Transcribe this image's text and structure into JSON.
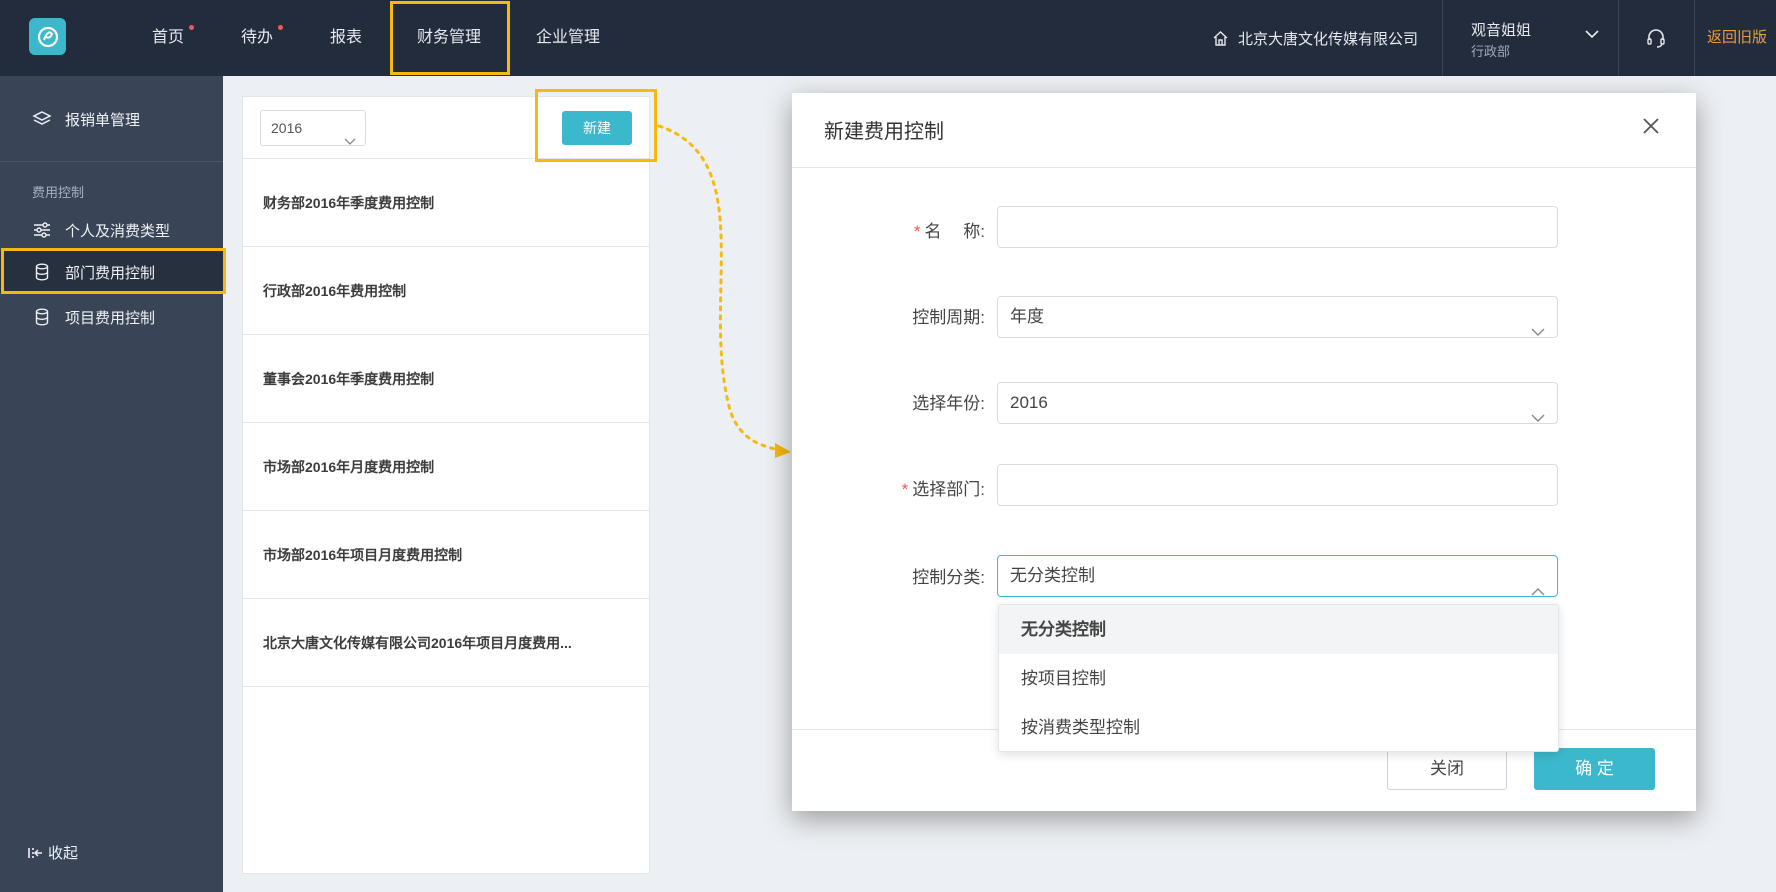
{
  "colors": {
    "topbar": "#232c3d",
    "sidebar": "#3a4457",
    "accent": "#3cb8cc",
    "highlight": "#f6b90d",
    "dot": "#f0595b",
    "old_version": "#ee9b3d"
  },
  "header": {
    "logo_icon": "app-logo-icon",
    "nav": [
      {
        "label": "首页",
        "dot": true
      },
      {
        "label": "待办",
        "dot": true
      },
      {
        "label": "报表",
        "dot": false
      },
      {
        "label": "财务管理",
        "dot": false,
        "active": true
      },
      {
        "label": "企业管理",
        "dot": false
      }
    ],
    "company": "北京大唐文化传媒有限公司",
    "user_name": "观音姐姐",
    "user_dept": "行政部",
    "old_version": "返回旧版"
  },
  "sidebar": {
    "top_item": "报销单管理",
    "group_label": "费用控制",
    "items": [
      {
        "label": "个人及消费类型",
        "icon": "sliders-icon"
      },
      {
        "label": "部门费用控制",
        "icon": "database-icon",
        "active": true
      },
      {
        "label": "项目费用控制",
        "icon": "database-icon"
      }
    ],
    "collapse": "收起"
  },
  "list": {
    "year": "2016",
    "new_button": "新建",
    "rows": [
      "财务部2016年季度费用控制",
      "行政部2016年费用控制",
      "董事会2016年季度费用控制",
      "市场部2016年月度费用控制",
      "市场部2016年项目月度费用控制",
      "北京大唐文化传媒有限公司2016年项目月度费用..."
    ]
  },
  "modal": {
    "title": "新建费用控制",
    "fields": {
      "name_label": "名　 称:",
      "name_value": "",
      "period_label": "控制周期:",
      "period_value": "年度",
      "year_label": "选择年份:",
      "year_value": "2016",
      "dept_label": "选择部门:",
      "dept_value": "",
      "category_label": "控制分类:",
      "category_value": "无分类控制"
    },
    "dropdown_options": [
      "无分类控制",
      "按项目控制",
      "按消费类型控制"
    ],
    "close_button": "关闭",
    "ok_button": "确 定"
  }
}
